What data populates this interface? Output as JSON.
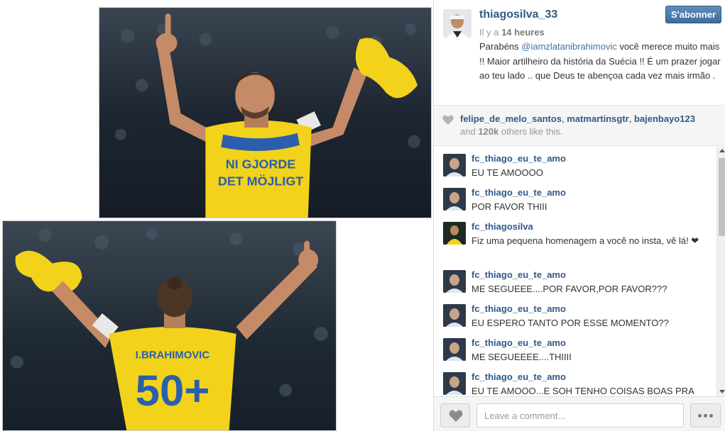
{
  "post": {
    "username": "thiagosilva_33",
    "follow_label": "S'abonner",
    "time_prefix": "Il y a ",
    "time_value": "14 heures",
    "caption_before": "Parabéns ",
    "caption_mention": "@iamzlatanibrahimovic",
    "caption_after": " você merece muito mais !! Maior artilheiro da história da Suécia !! É um prazer jogar ao teu lado .. que Deus te abençoa cada vez mais irmão .",
    "photo_top_shirt_text_1": "NI GJORDE",
    "photo_top_shirt_text_2": "DET MÖJLIGT",
    "photo_bottom_shirt_name": "I.BRAHIMOVIC",
    "photo_bottom_shirt_number": "50+"
  },
  "likes": {
    "user1": "felipe_de_melo_santos",
    "user2": "matmartinsgtr",
    "user3": "bajenbayo123",
    "others_prefix": "and ",
    "others_count": "120k",
    "others_suffix": " others like this."
  },
  "comments": [
    {
      "user": "fc_thiago_eu_te_amo",
      "text": "EU TE AMOOOO"
    },
    {
      "user": "fc_thiago_eu_te_amo",
      "text": "POR FAVOR THIII"
    },
    {
      "user": "fc_thiagosilva",
      "text": "Fiz uma pequena homenagem a você no insta, vê lá! ❤"
    },
    {
      "user": "fc_thiago_eu_te_amo",
      "text": "ME SEGUEEE....POR FAVOR,POR FAVOR???"
    },
    {
      "user": "fc_thiago_eu_te_amo",
      "text": "EU ESPERO TANTO POR ESSE MOMENTO??"
    },
    {
      "user": "fc_thiago_eu_te_amo",
      "text": "ME SEGUEEEE....THIIII"
    },
    {
      "user": "fc_thiago_eu_te_amo",
      "text": "EU TE AMOOO...E SOH TENHO COISAS BOAS PRA"
    }
  ],
  "footer": {
    "comment_placeholder": "Leave a comment..."
  },
  "icons": {
    "likes": "heart-icon",
    "like_button": "heart-icon",
    "more_button": "ellipsis-icon"
  },
  "colors": {
    "link": "#2f5a86",
    "follow_button": "#4a77a6",
    "jersey_yellow": "#f2d21b",
    "jersey_blue": "#2a5fae"
  }
}
